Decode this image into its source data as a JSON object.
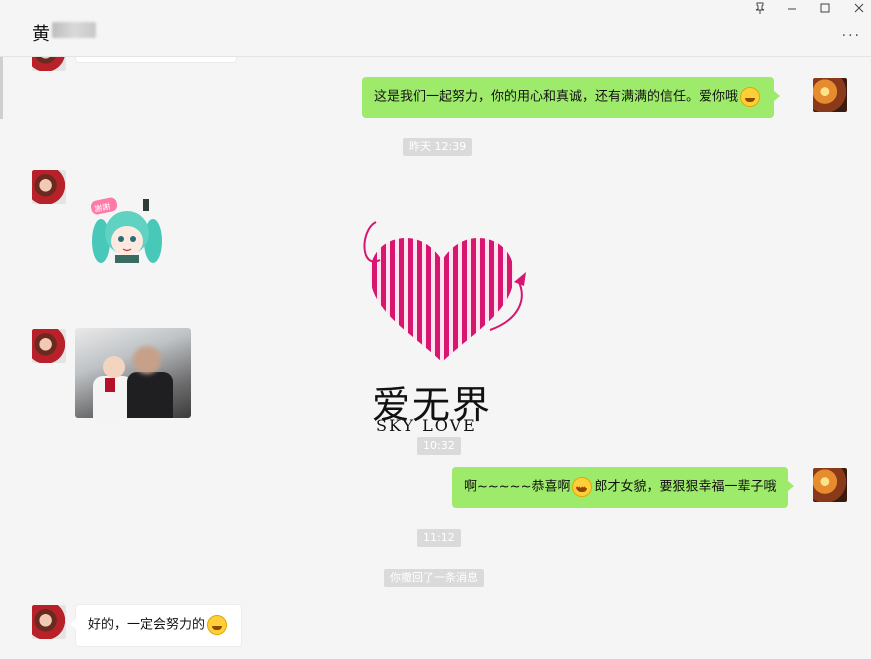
{
  "header": {
    "contact_name": "黄",
    "pin_icon": "pin-icon",
    "minimize_icon": "minimize-icon",
    "maximize_icon": "maximize-icon",
    "close_icon": "close-icon",
    "more_label": "..."
  },
  "messages": [
    {
      "type": "text",
      "side": "right",
      "text": "这是我们一起努力，你的用心和真诚，还有满满的信任。爱你哦",
      "emoji": "grin-emoji"
    },
    {
      "type": "timestamp",
      "text": "昨天 12:39"
    },
    {
      "type": "sticker",
      "side": "left",
      "sticker_text": "謝謝",
      "icon": "sticker-thanks-icon"
    },
    {
      "type": "image",
      "side": "left",
      "icon": "photo-couple-icon"
    },
    {
      "type": "timestamp",
      "text": "10:32"
    },
    {
      "type": "text",
      "side": "right",
      "text_before": "啊~~~~~恭喜啊",
      "text_after": "郎才女貌，要狠狠幸福一辈子哦",
      "emoji": "heart-eyes-emoji"
    },
    {
      "type": "timestamp",
      "text": "11:12"
    },
    {
      "type": "system",
      "text": "你撤回了一条消息"
    },
    {
      "type": "text",
      "side": "left",
      "text": "好的，一定会努力的",
      "emoji": "hug-emoji"
    }
  ],
  "watermark": {
    "title": "爱无界",
    "subtitle": "SKY LOVE",
    "icon": "heart-logo-icon",
    "color": "#d6166f"
  }
}
